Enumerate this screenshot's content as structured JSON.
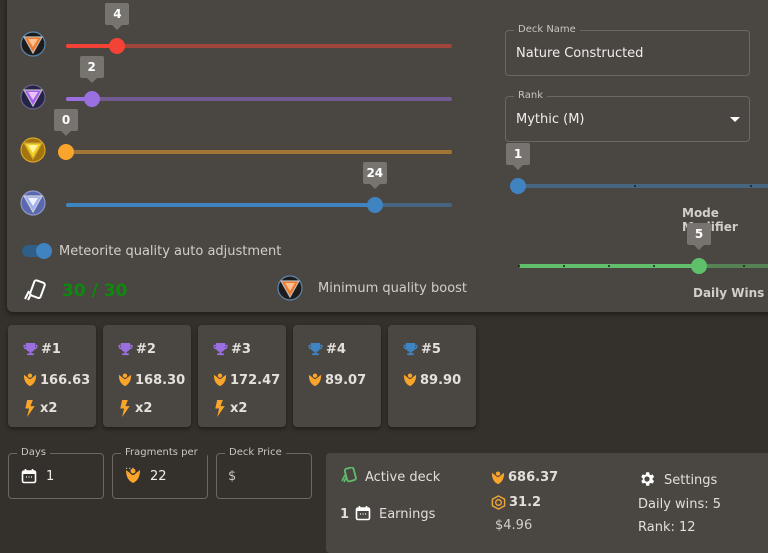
{
  "sliders": {
    "orange": {
      "value": 4,
      "max": 30,
      "color": "#f44336"
    },
    "purple": {
      "value": 2,
      "max": 30,
      "color": "#9a6fe0"
    },
    "gold": {
      "value": 0,
      "max": 30,
      "color": "#f9a42a"
    },
    "blue": {
      "value": 24,
      "max": 30,
      "color": "#3f83c0"
    }
  },
  "gem_icons": [
    "orange-meteorite-icon",
    "purple-meteorite-icon",
    "gold-meteorite-icon",
    "blue-meteorite-icon"
  ],
  "auto_adjust": {
    "label": "Meteorite quality auto adjustment",
    "enabled": true
  },
  "deck_count": {
    "text": "30 / 30",
    "color": "#0c8a0c"
  },
  "min_quality_boost": {
    "label": "Minimum quality boost"
  },
  "deck_name": {
    "legend": "Deck Name",
    "value": "Nature Constructed"
  },
  "rank": {
    "legend": "Rank",
    "value": "Mythic (M)"
  },
  "mode_modifier": {
    "label": "Mode Modifier",
    "value": 1,
    "min": 1,
    "max": 4,
    "color": "#3f83c0"
  },
  "daily_wins": {
    "label": "Daily Wins",
    "value": 5,
    "min": 1,
    "max": 7,
    "color": "#5fbf6a"
  },
  "ranks": [
    {
      "rank": "#1",
      "fragments": "166.63",
      "boost": "x2",
      "trophy_color": "#9a6fe0"
    },
    {
      "rank": "#2",
      "fragments": "168.30",
      "boost": "x2",
      "trophy_color": "#9a6fe0"
    },
    {
      "rank": "#3",
      "fragments": "172.47",
      "boost": "x2",
      "trophy_color": "#9a6fe0"
    },
    {
      "rank": "#4",
      "fragments": "89.07",
      "boost": null,
      "trophy_color": "#3f83c0"
    },
    {
      "rank": "#5",
      "fragments": "89.90",
      "boost": null,
      "trophy_color": "#3f83c0"
    }
  ],
  "inputs": {
    "days": {
      "legend": "Days",
      "value": "1"
    },
    "fragments": {
      "legend": "Fragments per ...",
      "value": "22"
    },
    "price": {
      "legend": "Deck Price",
      "value": "$"
    }
  },
  "summary": {
    "active_deck": "Active deck",
    "days": "1",
    "earnings": "Earnings",
    "fragments": "686.37",
    "crystals": "31.2",
    "usd": "$4.96",
    "settings": "Settings",
    "daily_wins": "Daily wins: 5",
    "rank": "Rank: 12"
  },
  "colors": {
    "accent_orange": "#f9a42a",
    "panel": "#4a4642",
    "bg": "#34302b"
  }
}
